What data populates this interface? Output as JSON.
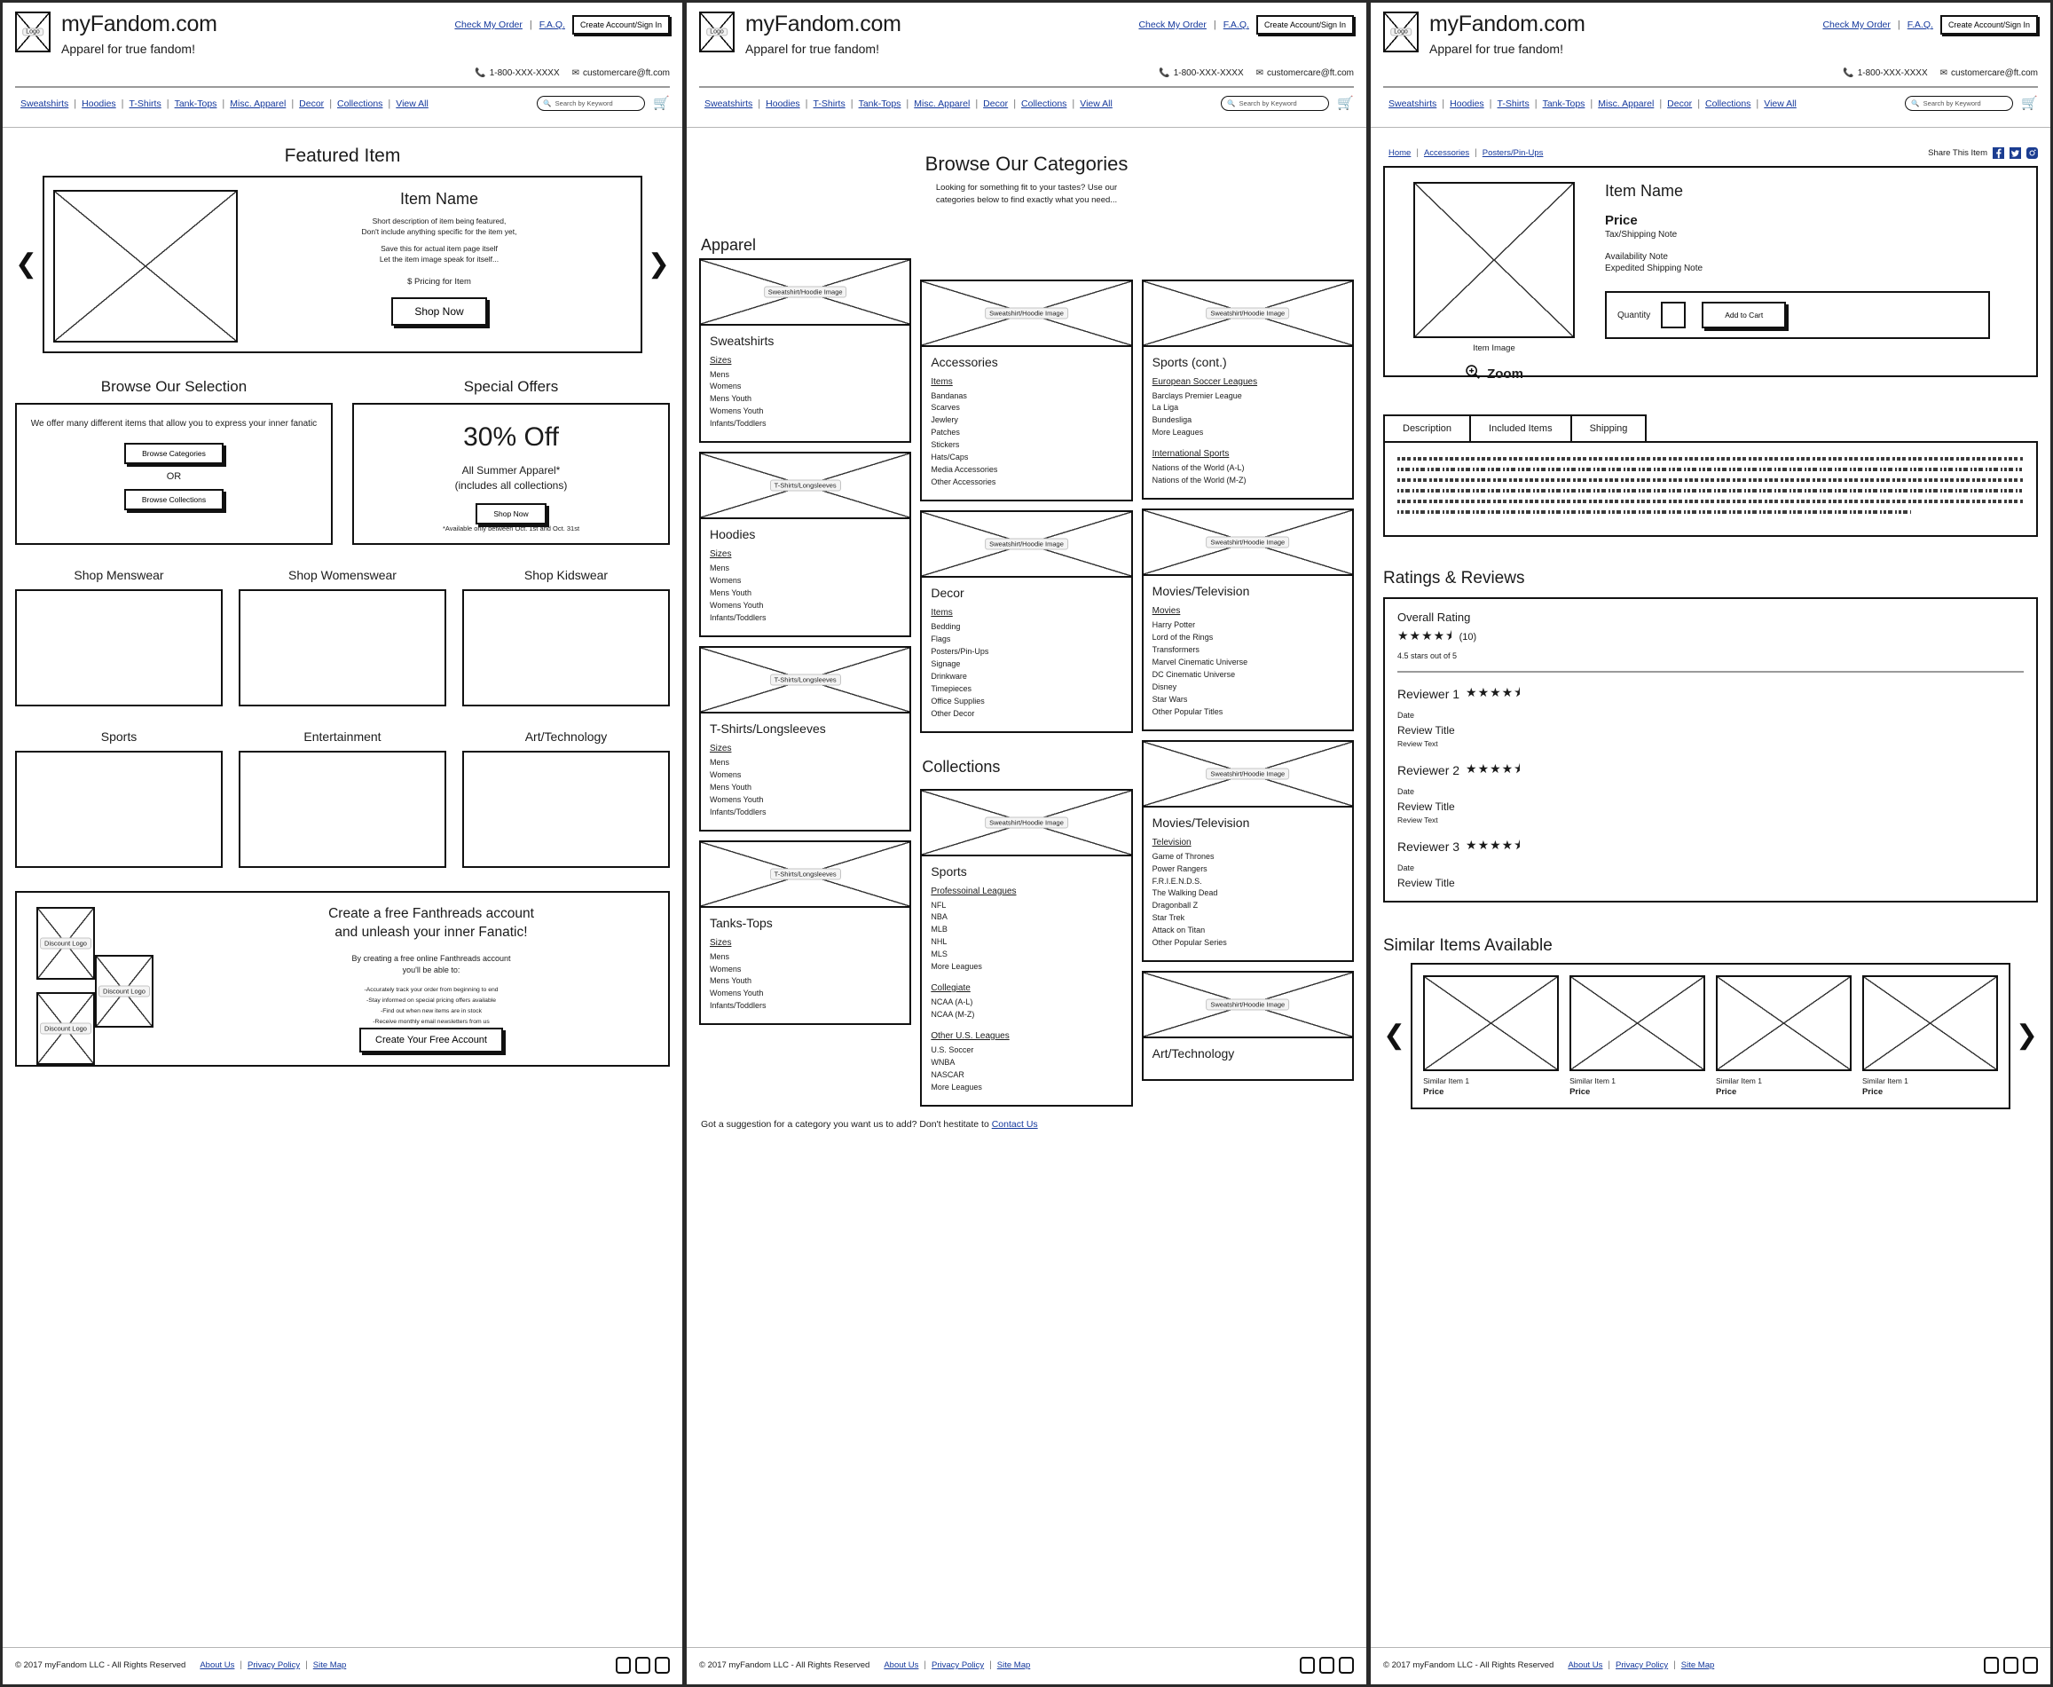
{
  "header": {
    "logo_label": "Logo",
    "brand": "myFandom.com",
    "tagline": "Apparel for true fandom!",
    "links": [
      "Check My Order",
      "F.A.Q."
    ],
    "account_button": "Create Account/Sign In",
    "phone": "1-800-XXX-XXXX",
    "email": "customercare@ft.com",
    "nav": [
      "Sweatshirts",
      "Hoodies",
      "T-Shirts",
      "Tank-Tops",
      "Misc. Apparel",
      "Decor",
      "Collections",
      "View All"
    ],
    "search_placeholder": "Search by Keyword"
  },
  "footer": {
    "copyright": "© 2017 myFandom LLC  -  All Rights Reserved",
    "links": [
      "About Us",
      "Privacy Policy",
      "Site Map"
    ]
  },
  "home": {
    "featured_title": "Featured Item",
    "item_name": "Item Name",
    "item_desc_1": "Short description of item being featured,",
    "item_desc_2": "Don't include anything specific for the item yet,",
    "item_desc_3": "Save this for actual item page itself",
    "item_desc_4": "Let the item image speak for itself...",
    "item_price": "$ Pricing for Item",
    "shop_now": "Shop Now",
    "browse_title": "Browse Our Selection",
    "browse_copy": "We offer many different items that allow you to express your inner fanatic",
    "browse_categories": "Browse Categories",
    "or": "OR",
    "browse_collections": "Browse Collections",
    "offers_title": "Special Offers",
    "offer_headline": "30% Off",
    "offer_sub_1": "All Summer Apparel*",
    "offer_sub_2": "(includes all collections)",
    "offer_shop_now": "Shop Now",
    "offer_fine": "*Available only between Oct. 1st and Oct. 31st",
    "shop_grid": [
      "Shop Menswear",
      "Shop Womenswear",
      "Shop Kidswear",
      "Sports",
      "Entertainment",
      "Art/Technology"
    ],
    "promo_logo_label": "Discount Logo",
    "promo_title_1": "Create a free Fanthreads account",
    "promo_title_2": "and unleash your inner Fanatic!",
    "promo_sub_1": "By creating a free online Fanthreads account",
    "promo_sub_2": "you'll be able to:",
    "promo_bullets": [
      "-Accurately track your order from beginning to end",
      "-Stay informed on special pricing offers available",
      "-Find out when new items are in stock",
      "-Receive monthly email newsletters from us"
    ],
    "promo_button": "Create Your Free Account"
  },
  "categories": {
    "title": "Browse Our Categories",
    "intro_1": "Looking for something fit to your tastes? Use our",
    "intro_2": "categories below to find exactly what you need...",
    "apparel_label": "Apparel",
    "collections_label": "Collections",
    "image_label": "Sweatshirt/Hoodie Image",
    "image_label_tee": "T-Shirts/Longsleeves",
    "suggest_text": "Got a suggestion for a category you want us to add? Don't hestitate to ",
    "suggest_link": "Contact Us",
    "sizes_heading": "Sizes",
    "items_heading": "Items",
    "sizes": [
      "Mens",
      "Womens",
      "Mens Youth",
      "Womens Youth",
      "Infants/Toddlers"
    ],
    "col1": [
      {
        "name": "Sweatshirts",
        "img": "Sweatshirt/Hoodie Image",
        "groups": [
          {
            "heading": "Sizes",
            "items": [
              "Mens",
              "Womens",
              "Mens Youth",
              "Womens Youth",
              "Infants/Toddlers"
            ]
          }
        ]
      },
      {
        "name": "Hoodies",
        "img": "T-Shirts/Longsleeves",
        "groups": [
          {
            "heading": "Sizes",
            "items": [
              "Mens",
              "Womens",
              "Mens Youth",
              "Womens Youth",
              "Infants/Toddlers"
            ]
          }
        ]
      },
      {
        "name": "T-Shirts/Longsleeves",
        "img": "T-Shirts/Longsleeves",
        "groups": [
          {
            "heading": "Sizes",
            "items": [
              "Mens",
              "Womens",
              "Mens Youth",
              "Womens Youth",
              "Infants/Toddlers"
            ]
          }
        ]
      },
      {
        "name": "Tanks-Tops",
        "img": "T-Shirts/Longsleeves",
        "groups": [
          {
            "heading": "Sizes",
            "items": [
              "Mens",
              "Womens",
              "Mens Youth",
              "Womens Youth",
              "Infants/Toddlers"
            ]
          }
        ]
      }
    ],
    "col2": [
      {
        "name": "Accessories",
        "img": "Sweatshirt/Hoodie Image",
        "groups": [
          {
            "heading": "Items",
            "items": [
              "Bandanas",
              "Scarves",
              "Jewlery",
              "Patches",
              "Stickers",
              "Hats/Caps",
              "Media Accessories",
              "Other Accessories"
            ]
          }
        ]
      },
      {
        "name": "Decor",
        "img": "Sweatshirt/Hoodie Image",
        "groups": [
          {
            "heading": "Items",
            "items": [
              "Bedding",
              "Flags",
              "Posters/Pin-Ups",
              "Signage",
              "Drinkware",
              "Timepieces",
              "Office Supplies",
              "Other Decor"
            ]
          }
        ]
      },
      {
        "name": "Sports",
        "img": "Sweatshirt/Hoodie Image",
        "groups": [
          {
            "heading": "Professoinal Leagues",
            "items": [
              "NFL",
              "NBA",
              "MLB",
              "NHL",
              "MLS",
              "More Leagues"
            ]
          },
          {
            "heading": "Collegiate",
            "items": [
              "NCAA (A-L)",
              "NCAA (M-Z)"
            ]
          },
          {
            "heading": "Other U.S. Leagues",
            "items": [
              "U.S. Soccer",
              "WNBA",
              "NASCAR",
              "More Leagues"
            ]
          }
        ]
      }
    ],
    "col3": [
      {
        "name": "Sports (cont.)",
        "img": "Sweatshirt/Hoodie Image",
        "groups": [
          {
            "heading": "European Soccer Leagues",
            "items": [
              "Barclays Premier League",
              "La Liga",
              "Bundesliga",
              "More Leagues"
            ]
          },
          {
            "heading": "International Sports",
            "items": [
              "Nations of the World (A-L)",
              "Nations of the World (M-Z)"
            ]
          }
        ]
      },
      {
        "name": "Movies/Television",
        "img": "Sweatshirt/Hoodie Image",
        "groups": [
          {
            "heading": "Movies",
            "items": [
              "Harry Potter",
              "Lord of the Rings",
              "Transformers",
              "Marvel Cinematic Universe",
              "DC Cinematic Universe",
              "Disney",
              "Star Wars",
              "Other Popular Titles"
            ]
          }
        ]
      },
      {
        "name": "Movies/Television",
        "img": "Sweatshirt/Hoodie Image",
        "groups": [
          {
            "heading": "Television",
            "items": [
              "Game of Thrones",
              "Power Rangers",
              "F.R.I.E.N.D.S.",
              "The Walking Dead",
              "Dragonball Z",
              "Star Trek",
              "Attack on Titan",
              "Other Popular Series"
            ]
          }
        ]
      },
      {
        "name": "Art/Technology",
        "img": "Sweatshirt/Hoodie Image",
        "groups": []
      }
    ]
  },
  "product": {
    "breadcrumbs": [
      "Home",
      "Accessories",
      "Posters/Pin-Ups"
    ],
    "share_label": "Share This Item",
    "item_name": "Item Name",
    "price": "Price",
    "tax_note": "Tax/Shipping Note",
    "availability_note": "Availability Note",
    "expedited_note": "Expedited Shipping Note",
    "image_caption": "Item Image",
    "zoom_label": "Zoom",
    "quantity_label": "Quantity",
    "quantity_value": "",
    "add_to_cart": "Add to Cart",
    "tabs": [
      "Description",
      "Included Items",
      "Shipping"
    ],
    "ratings_title": "Ratings & Reviews",
    "overall_label": "Overall Rating",
    "overall_stars": "★★★★⯨",
    "overall_count": "(10)",
    "overall_text": "4.5 stars out of 5",
    "reviews": [
      {
        "name": "Reviewer 1",
        "stars": "★★★★⯨",
        "date": "Date",
        "title": "Review Title",
        "text": "Review Text"
      },
      {
        "name": "Reviewer 2",
        "stars": "★★★★⯨",
        "date": "Date",
        "title": "Review Title",
        "text": "Review Text"
      },
      {
        "name": "Reviewer 3",
        "stars": "★★★★⯨",
        "date": "Date",
        "title": "Review Title",
        "text": ""
      }
    ],
    "similar_title": "Similar Items Available",
    "similar_items": [
      {
        "name": "Similar Item 1",
        "price": "Price"
      },
      {
        "name": "Similar Item 1",
        "price": "Price"
      },
      {
        "name": "Similar Item 1",
        "price": "Price"
      },
      {
        "name": "Similar Item 1",
        "price": "Price"
      }
    ]
  }
}
